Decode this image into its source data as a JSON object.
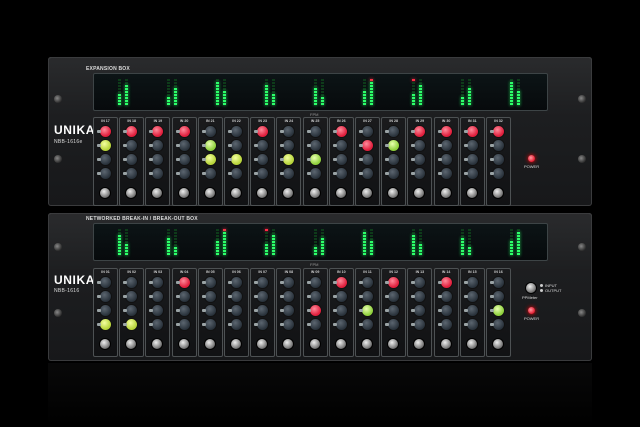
{
  "top_unit": {
    "header": "EXPANSION BOX",
    "brand": "UNIKA",
    "model": "NBB-1616e",
    "fpm": "FPM",
    "power": "POWER",
    "channels": [
      "IN 17",
      "IN 18",
      "IN 19",
      "IN 20",
      "IN 21",
      "IN 22",
      "IN 23",
      "IN 24",
      "IN 25",
      "IN 26",
      "IN 27",
      "IN 28",
      "IN 29",
      "IN 30",
      "IN 31",
      "IN 32"
    ]
  },
  "bottom_unit": {
    "header": "NETWORKED BREAK-IN / BREAK-OUT BOX",
    "brand": "UNIKA",
    "model": "NBB-1616",
    "fpm": "FPM",
    "power": "POWER",
    "ppmeter": "PPMeter",
    "input": "INPUT",
    "output": "OUTPUT",
    "channels": [
      "IN 01",
      "IN 02",
      "IN 03",
      "IN 04",
      "IN 05",
      "IN 06",
      "IN 07",
      "IN 08",
      "IN 09",
      "IN 10",
      "IN 11",
      "IN 12",
      "IN 13",
      "IN 14",
      "IN 15",
      "IN 16"
    ]
  },
  "colors": {
    "led_green": "#2dff6a",
    "led_red": "#ff2b45",
    "knob_red": "#e01e3c",
    "knob_yellow": "#b7d43a",
    "panel": "#1d1e20"
  }
}
